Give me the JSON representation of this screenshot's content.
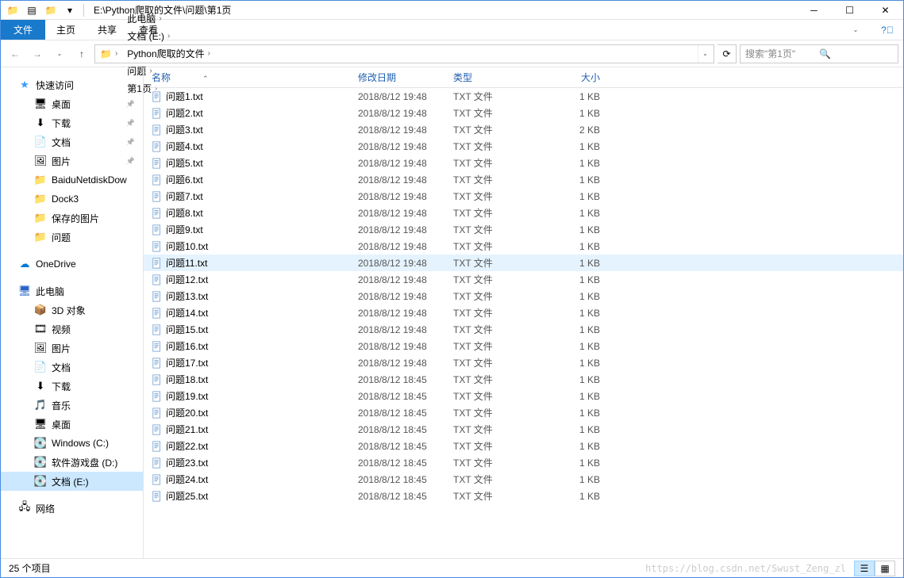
{
  "title_path": "E:\\Python爬取的文件\\问题\\第1页",
  "ribbon": {
    "file": "文件",
    "home": "主页",
    "share": "共享",
    "view": "查看"
  },
  "breadcrumb": [
    "此电脑",
    "文档 (E:)",
    "Python爬取的文件",
    "问题",
    "第1页"
  ],
  "search_placeholder": "搜索\"第1页\"",
  "columns": {
    "name": "名称",
    "date": "修改日期",
    "type": "类型",
    "size": "大小"
  },
  "sidebar": {
    "quick_access": "快速访问",
    "quick_items": [
      {
        "label": "桌面",
        "icon": "🖥",
        "pinned": true
      },
      {
        "label": "下载",
        "icon": "⬇",
        "pinned": true
      },
      {
        "label": "文档",
        "icon": "📄",
        "pinned": true
      },
      {
        "label": "图片",
        "icon": "🖼",
        "pinned": true
      },
      {
        "label": "BaiduNetdiskDow",
        "icon": "📁"
      },
      {
        "label": "Dock3",
        "icon": "📁"
      },
      {
        "label": "保存的图片",
        "icon": "📁"
      },
      {
        "label": "问题",
        "icon": "📁"
      }
    ],
    "onedrive": "OneDrive",
    "this_pc": "此电脑",
    "pc_items": [
      {
        "label": "3D 对象",
        "icon": "📦"
      },
      {
        "label": "视频",
        "icon": "🎞"
      },
      {
        "label": "图片",
        "icon": "🖼"
      },
      {
        "label": "文档",
        "icon": "📄"
      },
      {
        "label": "下载",
        "icon": "⬇"
      },
      {
        "label": "音乐",
        "icon": "🎵"
      },
      {
        "label": "桌面",
        "icon": "🖥"
      },
      {
        "label": "Windows (C:)",
        "icon": "💽"
      },
      {
        "label": "软件游戏盘 (D:)",
        "icon": "💽"
      },
      {
        "label": "文档 (E:)",
        "icon": "💽",
        "selected": true
      }
    ],
    "network": "网络"
  },
  "files": [
    {
      "name": "问题1.txt",
      "date": "2018/8/12 19:48",
      "type": "TXT 文件",
      "size": "1 KB"
    },
    {
      "name": "问题2.txt",
      "date": "2018/8/12 19:48",
      "type": "TXT 文件",
      "size": "1 KB"
    },
    {
      "name": "问题3.txt",
      "date": "2018/8/12 19:48",
      "type": "TXT 文件",
      "size": "2 KB"
    },
    {
      "name": "问题4.txt",
      "date": "2018/8/12 19:48",
      "type": "TXT 文件",
      "size": "1 KB"
    },
    {
      "name": "问题5.txt",
      "date": "2018/8/12 19:48",
      "type": "TXT 文件",
      "size": "1 KB"
    },
    {
      "name": "问题6.txt",
      "date": "2018/8/12 19:48",
      "type": "TXT 文件",
      "size": "1 KB"
    },
    {
      "name": "问题7.txt",
      "date": "2018/8/12 19:48",
      "type": "TXT 文件",
      "size": "1 KB"
    },
    {
      "name": "问题8.txt",
      "date": "2018/8/12 19:48",
      "type": "TXT 文件",
      "size": "1 KB"
    },
    {
      "name": "问题9.txt",
      "date": "2018/8/12 19:48",
      "type": "TXT 文件",
      "size": "1 KB"
    },
    {
      "name": "问题10.txt",
      "date": "2018/8/12 19:48",
      "type": "TXT 文件",
      "size": "1 KB"
    },
    {
      "name": "问题11.txt",
      "date": "2018/8/12 19:48",
      "type": "TXT 文件",
      "size": "1 KB",
      "hl": true
    },
    {
      "name": "问题12.txt",
      "date": "2018/8/12 19:48",
      "type": "TXT 文件",
      "size": "1 KB"
    },
    {
      "name": "问题13.txt",
      "date": "2018/8/12 19:48",
      "type": "TXT 文件",
      "size": "1 KB"
    },
    {
      "name": "问题14.txt",
      "date": "2018/8/12 19:48",
      "type": "TXT 文件",
      "size": "1 KB"
    },
    {
      "name": "问题15.txt",
      "date": "2018/8/12 19:48",
      "type": "TXT 文件",
      "size": "1 KB"
    },
    {
      "name": "问题16.txt",
      "date": "2018/8/12 19:48",
      "type": "TXT 文件",
      "size": "1 KB"
    },
    {
      "name": "问题17.txt",
      "date": "2018/8/12 19:48",
      "type": "TXT 文件",
      "size": "1 KB"
    },
    {
      "name": "问题18.txt",
      "date": "2018/8/12 18:45",
      "type": "TXT 文件",
      "size": "1 KB"
    },
    {
      "name": "问题19.txt",
      "date": "2018/8/12 18:45",
      "type": "TXT 文件",
      "size": "1 KB"
    },
    {
      "name": "问题20.txt",
      "date": "2018/8/12 18:45",
      "type": "TXT 文件",
      "size": "1 KB"
    },
    {
      "name": "问题21.txt",
      "date": "2018/8/12 18:45",
      "type": "TXT 文件",
      "size": "1 KB"
    },
    {
      "name": "问题22.txt",
      "date": "2018/8/12 18:45",
      "type": "TXT 文件",
      "size": "1 KB"
    },
    {
      "name": "问题23.txt",
      "date": "2018/8/12 18:45",
      "type": "TXT 文件",
      "size": "1 KB"
    },
    {
      "name": "问题24.txt",
      "date": "2018/8/12 18:45",
      "type": "TXT 文件",
      "size": "1 KB"
    },
    {
      "name": "问题25.txt",
      "date": "2018/8/12 18:45",
      "type": "TXT 文件",
      "size": "1 KB"
    }
  ],
  "status": {
    "count": "25 个项目",
    "watermark": "https://blog.csdn.net/Swust_Zeng_zl"
  }
}
